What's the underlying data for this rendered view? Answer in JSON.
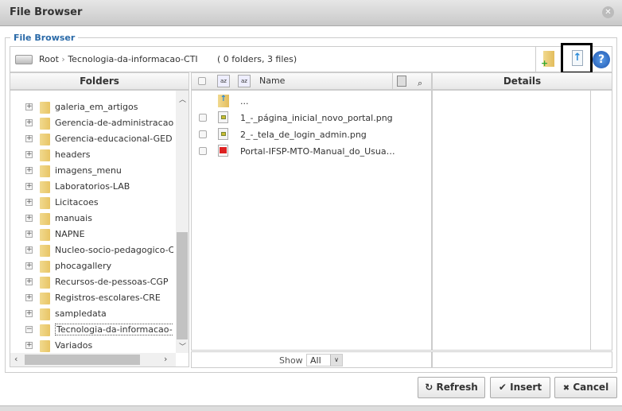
{
  "dialog": {
    "title": "File Browser",
    "legend": "File Browser"
  },
  "toolbar": {
    "root": "Root",
    "separator": "›",
    "current": "Tecnologia-da-informacao-CTI",
    "info": "( 0 folders, 3 files)",
    "icons": [
      "new-folder-icon",
      "upload-icon",
      "help-icon"
    ]
  },
  "headers": {
    "folders": "Folders",
    "name": "Name",
    "details": "Details"
  },
  "folders": [
    {
      "label": "galeria_em_artigos",
      "expander": "+"
    },
    {
      "label": "Gerencia-de-administracao",
      "expander": "+"
    },
    {
      "label": "Gerencia-educacional-GED",
      "expander": "+"
    },
    {
      "label": "headers",
      "expander": "+"
    },
    {
      "label": "imagens_menu",
      "expander": "+"
    },
    {
      "label": "Laboratorios-LAB",
      "expander": "+"
    },
    {
      "label": "Licitacoes",
      "expander": "+"
    },
    {
      "label": "manuais",
      "expander": "+"
    },
    {
      "label": "NAPNE",
      "expander": "+"
    },
    {
      "label": "Nucleo-socio-pedagogico-C",
      "expander": "+"
    },
    {
      "label": "phocagallery",
      "expander": "+"
    },
    {
      "label": "Recursos-de-pessoas-CGP",
      "expander": "+"
    },
    {
      "label": "Registros-escolares-CRE",
      "expander": "+"
    },
    {
      "label": "sampledata",
      "expander": "+"
    },
    {
      "label": "Tecnologia-da-informacao-",
      "expander": "−"
    },
    {
      "label": "Variados",
      "expander": "+"
    }
  ],
  "files": {
    "up": "...",
    "items": [
      {
        "name": "1_-_página_inicial_novo_portal.png",
        "type": "image"
      },
      {
        "name": "2_-_tela_de_login_admin.png",
        "type": "image"
      },
      {
        "name": "Portal-IFSP-MTO-Manual_do_Usua…",
        "type": "pdf"
      }
    ]
  },
  "footer": {
    "show_label": "Show",
    "show_value": "All"
  },
  "buttons": {
    "refresh": "Refresh",
    "insert": "Insert",
    "cancel": "Cancel"
  },
  "icons": {
    "refresh": "↻",
    "insert": "✔",
    "cancel": "✖"
  }
}
